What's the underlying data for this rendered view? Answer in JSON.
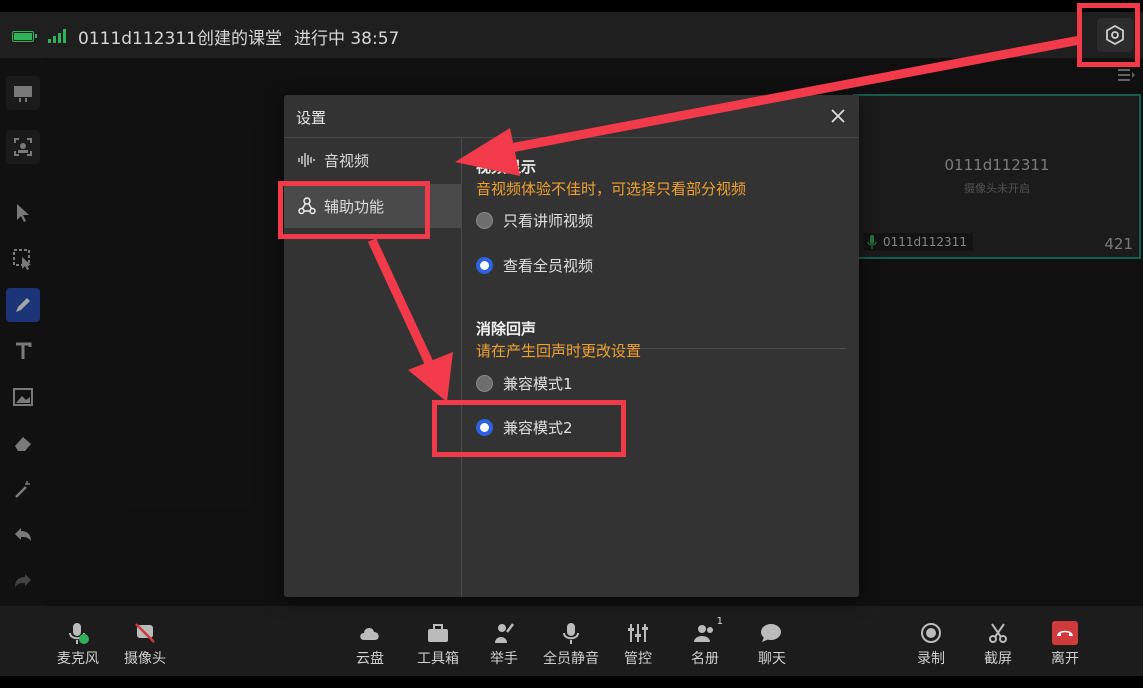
{
  "topbar": {
    "class_title": "0111d112311创建的课堂",
    "status": "进行中 38:57",
    "settings_icon": "settings-hexagon-icon"
  },
  "colors": {
    "accent_blue": "#2d62e0",
    "hint_orange": "#f0a030",
    "annotation_red": "#f23a4a",
    "network_green": "#2fb25a"
  },
  "video_card": {
    "name": "0111d112311",
    "camera_status": "摄像头未开启",
    "user": "0111d112311",
    "number": "421"
  },
  "dialog": {
    "title": "设置",
    "sidebar": [
      {
        "label": "音视频",
        "icon": "waveform-icon"
      },
      {
        "label": "辅助功能",
        "icon": "accessibility-icon"
      }
    ],
    "video_section": {
      "title": "视频显示",
      "hint": "音视频体验不佳时，可选择只看部分视频",
      "options": [
        "只看讲师视频",
        "查看全员视频"
      ],
      "selected": "查看全员视频"
    },
    "echo_section": {
      "title": "消除回声",
      "hint": "请在产生回声时更改设置",
      "options": [
        "兼容模式1",
        "兼容模式2"
      ],
      "selected": "兼容模式2"
    }
  },
  "bottombar": {
    "mic": "麦克风",
    "camera": "摄像头",
    "cloud": "云盘",
    "toolbox": "工具箱",
    "raise_hand": "举手",
    "mute_all": "全员静音",
    "control": "管控",
    "roster": "名册",
    "roster_badge": "1",
    "chat": "聊天",
    "record": "录制",
    "screenshot": "截屏",
    "leave": "离开"
  }
}
